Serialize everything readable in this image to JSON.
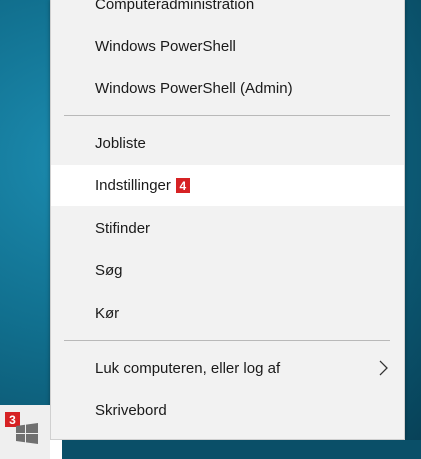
{
  "menu": {
    "items": [
      {
        "label": "Computeradministration"
      },
      {
        "label": "Windows PowerShell"
      },
      {
        "label": "Windows PowerShell (Admin)"
      },
      {
        "label": "Jobliste"
      },
      {
        "label": "Indstillinger",
        "badge": "4"
      },
      {
        "label": "Stifinder"
      },
      {
        "label": "Søg"
      },
      {
        "label": "Kør"
      },
      {
        "label": "Luk computeren, eller log af",
        "submenu_icon": "chevron-right-icon"
      },
      {
        "label": "Skrivebord"
      }
    ]
  },
  "start": {
    "badge": "3",
    "icon": "windows-logo-icon"
  },
  "colors": {
    "desktop": "#11708f",
    "menu_bg": "#f2f2f2",
    "hover_bg": "#ffffff",
    "badge": "#d62224",
    "windows_logo": "#707070"
  }
}
